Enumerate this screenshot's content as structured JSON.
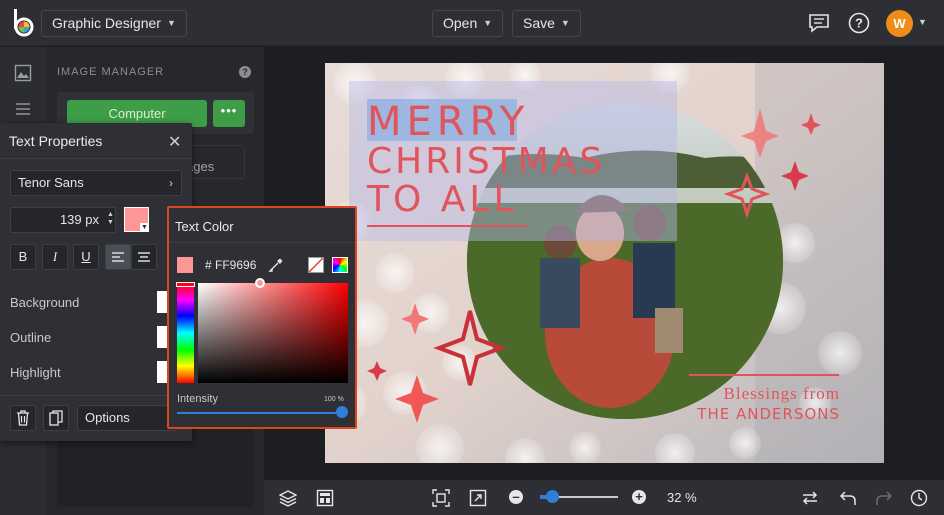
{
  "header": {
    "project_name": "Graphic Designer",
    "open_label": "Open",
    "save_label": "Save",
    "avatar_initial": "W"
  },
  "image_manager": {
    "title": "IMAGE MANAGER",
    "help": "?",
    "computer_label": "Computer",
    "more_label": "•••",
    "images_label": "ages"
  },
  "text_properties": {
    "title": "Text Properties",
    "font": "Tenor Sans",
    "font_size": "139 px",
    "text_color": "#ff9696",
    "bold": "B",
    "italic": "I",
    "underline": "U",
    "background_label": "Background",
    "outline_label": "Outline",
    "highlight_label": "Highlight",
    "options_label": "Options"
  },
  "text_color": {
    "title": "Text Color",
    "hex": "# FF9696",
    "intensity_label": "Intensity",
    "intensity_value": "100 %",
    "intensity": 1.0
  },
  "design": {
    "line1": "MERRY",
    "line2": "CHRISTMAS",
    "line3": "TO ALL",
    "blessing1": "Blessings from",
    "blessing2": "THE ANDERSONS",
    "text_color": "#e2545c"
  },
  "zoom": {
    "label": "32 %",
    "value": 0.32
  },
  "colors": {
    "accent": "#2f7fd8",
    "green": "#3e9e47",
    "highlight_border": "#e0441e"
  }
}
